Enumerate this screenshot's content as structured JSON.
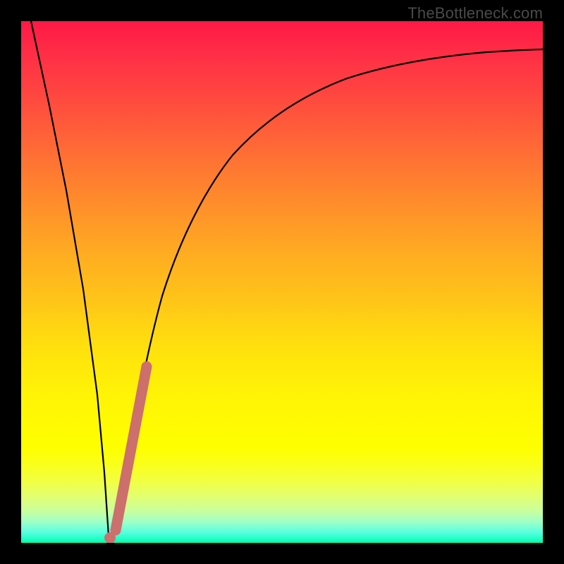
{
  "watermark": "TheBottleneck.com",
  "colors": {
    "frame": "#000000",
    "curve": "#000000",
    "accent_segment": "#cd6f6c"
  },
  "chart_data": {
    "type": "line",
    "title": "",
    "xlabel": "",
    "ylabel": "",
    "xlim": [
      0,
      100
    ],
    "ylim": [
      0,
      100
    ],
    "grid": false,
    "legend": false,
    "series": [
      {
        "name": "descending-curve",
        "x": [
          0,
          2,
          4,
          6,
          8,
          10,
          12,
          14,
          15
        ],
        "y": [
          100,
          87,
          73,
          60,
          47,
          33,
          20,
          7,
          1
        ]
      },
      {
        "name": "ascending-curve",
        "x": [
          15,
          16,
          17,
          18,
          19,
          20,
          22,
          24,
          27,
          30,
          34,
          38,
          43,
          48,
          54,
          60,
          67,
          74,
          82,
          90,
          100
        ],
        "y": [
          1,
          4,
          9,
          15,
          22,
          28,
          38,
          47,
          56,
          63,
          70,
          75,
          79,
          82,
          85,
          87,
          89,
          90.5,
          91.5,
          92.3,
          93
        ]
      }
    ],
    "accent_segment": {
      "name": "highlight-bar",
      "x_start": 17,
      "y_start": 9,
      "x_end": 22,
      "y_end": 38
    }
  }
}
